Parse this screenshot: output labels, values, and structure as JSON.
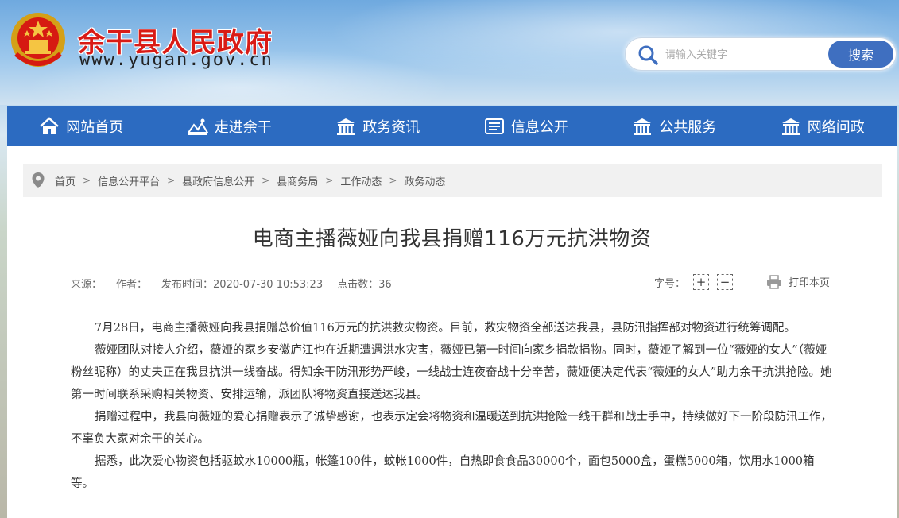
{
  "header": {
    "site_name": "余干县人民政府",
    "site_domain": "www.yugan.gov.cn",
    "emblem_icon": "national-emblem-icon"
  },
  "search": {
    "placeholder": "请输入关键字",
    "button_label": "搜索"
  },
  "nav": {
    "items": [
      {
        "label": "网站首页",
        "icon": "home-icon"
      },
      {
        "label": "走进余干",
        "icon": "landscape-icon"
      },
      {
        "label": "政务资讯",
        "icon": "building-icon"
      },
      {
        "label": "信息公开",
        "icon": "document-icon"
      },
      {
        "label": "公共服务",
        "icon": "building-icon"
      },
      {
        "label": "网络问政",
        "icon": "building-icon"
      }
    ]
  },
  "breadcrumb": [
    "首页",
    "信息公开平台",
    "县政府信息公开",
    "县商务局",
    "工作动态",
    "政务动态"
  ],
  "article": {
    "title": "电商主播薇娅向我县捐赠116万元抗洪物资",
    "source_label": "来源：",
    "author_label": "作者：",
    "publish_time": "发布时间：2020-07-30 10:53:23",
    "clicks": "点击数：36",
    "font_size_label": "字号：",
    "font_plus": "+",
    "font_minus": "−",
    "print_label": "打印本页",
    "paragraphs": [
      "7月28日，电商主播薇娅向我县捐赠总价值116万元的抗洪救灾物资。目前，救灾物资全部送达我县，县防汛指挥部对物资进行统筹调配。",
      "薇娅团队对接人介绍，薇娅的家乡安徽庐江也在近期遭遇洪水灾害，薇娅已第一时间向家乡捐款捐物。同时，薇娅了解到一位“薇娅的女人”（薇娅粉丝昵称）的丈夫正在我县抗洪一线奋战。得知余干防汛形势严峻，一线战士连夜奋战十分辛苦，薇娅便决定代表“薇娅的女人”助力余干抗洪抢险。她第一时间联系采购相关物资、安排运输，派团队将物资直接送达我县。",
      "捐赠过程中，我县向薇娅的爱心捐赠表示了诚挚感谢，也表示定会将物资和温暖送到抗洪抢险一线干群和战士手中，持续做好下一阶段防汛工作，不辜负大家对余干的关心。",
      "据悉，此次爱心物资包括驱蚊水10000瓶，帐篷100件，蚊帐1000件，自热即食食品30000个，面包5000盒，蛋糕5000箱，饮用水1000箱等。"
    ]
  },
  "colors": {
    "brand_red": "#d91b16",
    "nav_blue": "#2c6bc1",
    "search_button": "#3f6fc0"
  }
}
